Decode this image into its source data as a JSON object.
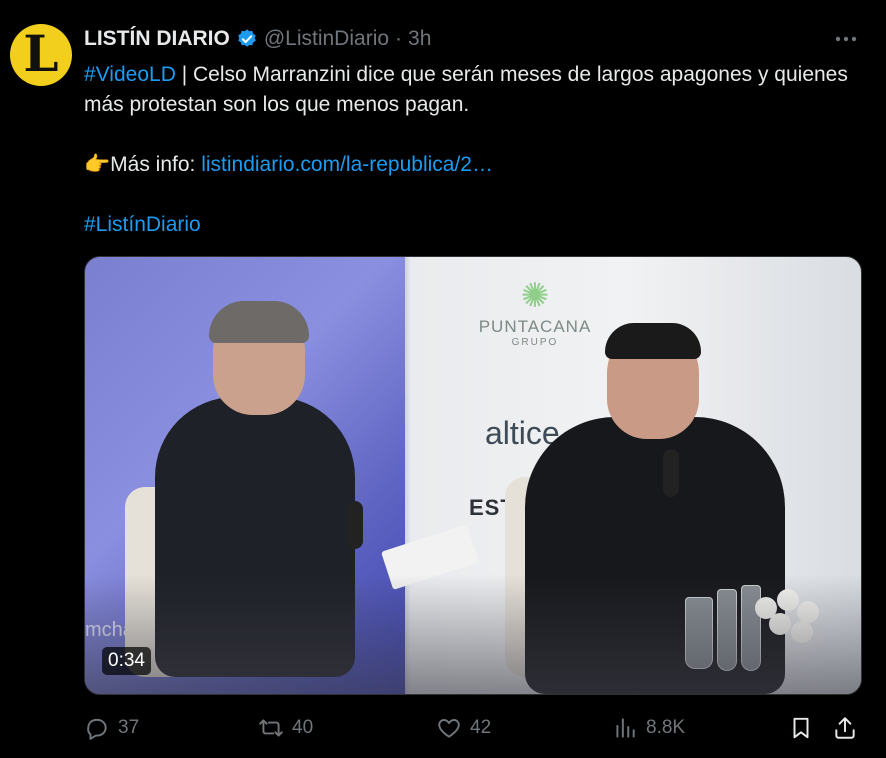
{
  "tweet": {
    "author_name": "LISTÍN DIARIO",
    "handle": "@ListinDiario",
    "separator": "·",
    "time": "3h",
    "avatar_letter": "L",
    "text_hashtag": "#VideoLD",
    "text_body": " | Celso Marranzini dice que serán meses de largos apagones y quienes más protestan son los que menos pagan.",
    "more_info_emoji": "👉",
    "more_info_label": "Más info: ",
    "more_info_link": "listindiario.com/la-republica/2…",
    "closing_hashtag": "#ListínDiario"
  },
  "media": {
    "duration": "0:34",
    "banner_brand": "PUNTACANA",
    "banner_sub": "GRUPO",
    "brand_second": "altice",
    "brand_third": "ESTR",
    "left_text": "mcha"
  },
  "actions": {
    "replies": "37",
    "reposts": "40",
    "likes": "42",
    "views": "8.8K"
  },
  "colors": {
    "background": "#000000",
    "text": "#e7e9ea",
    "muted": "#71767b",
    "link": "#1d9bf0",
    "avatar_bg": "#f2cf1c"
  }
}
